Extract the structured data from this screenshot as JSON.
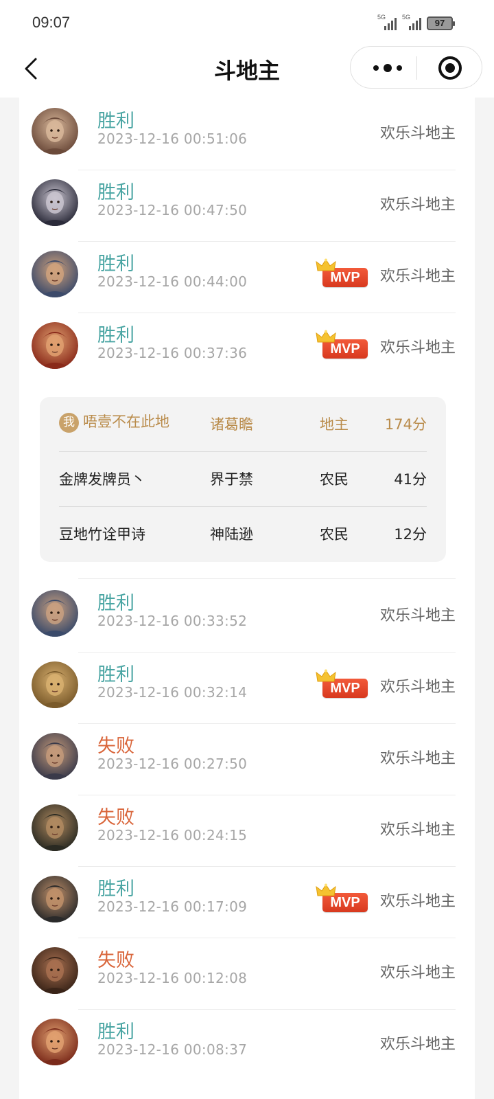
{
  "status_bar": {
    "time": "09:07",
    "signal1": "5G",
    "signal2": "5G",
    "battery": "97"
  },
  "nav": {
    "title": "斗地主"
  },
  "records_top": [
    {
      "result": "胜利",
      "type": "win",
      "time": "2023-12-16 00:51:06",
      "mvp": false,
      "mode": "欢乐斗地主",
      "avatar": "avatar-1"
    },
    {
      "result": "胜利",
      "type": "win",
      "time": "2023-12-16 00:47:50",
      "mvp": false,
      "mode": "欢乐斗地主",
      "avatar": "avatar-2"
    },
    {
      "result": "胜利",
      "type": "win",
      "time": "2023-12-16 00:44:00",
      "mvp": true,
      "mode": "欢乐斗地主",
      "avatar": "avatar-3"
    },
    {
      "result": "胜利",
      "type": "win",
      "time": "2023-12-16 00:37:36",
      "mvp": true,
      "mode": "欢乐斗地主",
      "avatar": "avatar-4"
    }
  ],
  "mvp_label": "MVP",
  "detail": {
    "me_badge": "我",
    "players": [
      {
        "name": "唔壹不在此地",
        "hero": "诸葛瞻",
        "role": "地主",
        "score": "174分"
      },
      {
        "name": "金牌发牌员丶",
        "hero": "界于禁",
        "role": "农民",
        "score": "41分"
      },
      {
        "name": "豆地竹诠甲诗",
        "hero": "神陆逊",
        "role": "农民",
        "score": "12分"
      }
    ]
  },
  "records_bottom": [
    {
      "result": "胜利",
      "type": "win",
      "time": "2023-12-16 00:33:52",
      "mvp": false,
      "mode": "欢乐斗地主",
      "avatar": "avatar-5"
    },
    {
      "result": "胜利",
      "type": "win",
      "time": "2023-12-16 00:32:14",
      "mvp": true,
      "mode": "欢乐斗地主",
      "avatar": "avatar-6"
    },
    {
      "result": "失败",
      "type": "lose",
      "time": "2023-12-16 00:27:50",
      "mvp": false,
      "mode": "欢乐斗地主",
      "avatar": "avatar-7"
    },
    {
      "result": "失败",
      "type": "lose",
      "time": "2023-12-16 00:24:15",
      "mvp": false,
      "mode": "欢乐斗地主",
      "avatar": "avatar-8"
    },
    {
      "result": "胜利",
      "type": "win",
      "time": "2023-12-16 00:17:09",
      "mvp": true,
      "mode": "欢乐斗地主",
      "avatar": "avatar-9"
    },
    {
      "result": "失败",
      "type": "lose",
      "time": "2023-12-16 00:12:08",
      "mvp": false,
      "mode": "欢乐斗地主",
      "avatar": "avatar-10"
    },
    {
      "result": "胜利",
      "type": "win",
      "time": "2023-12-16 00:08:37",
      "mvp": false,
      "mode": "欢乐斗地主",
      "avatar": "avatar-11"
    }
  ],
  "colors": {
    "win": "#4aa5a3",
    "lose": "#d9653a",
    "gold": "#b98b4a"
  },
  "icons": {
    "back": "chevron-left-icon",
    "more": "more-dots-icon",
    "close": "target-circle-icon",
    "mvp_crown": "crown-icon"
  }
}
